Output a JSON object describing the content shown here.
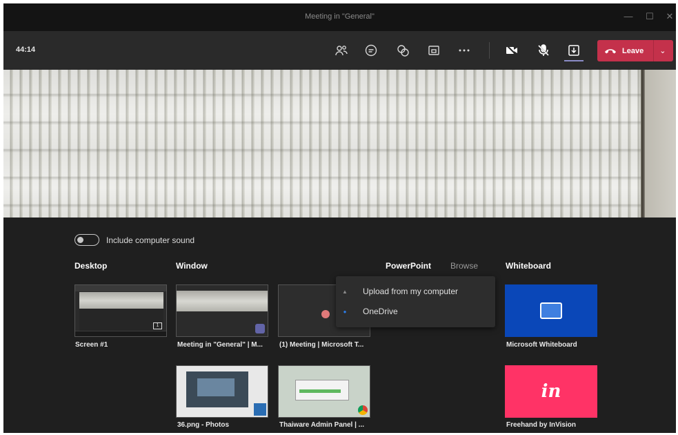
{
  "window": {
    "title": "Meeting in \"General\"",
    "controls": [
      "minimize-icon",
      "maximize-icon",
      "close-icon"
    ]
  },
  "toolbar": {
    "timer": "44:14",
    "icons": [
      "participants-icon",
      "chat-icon",
      "reactions-icon",
      "rooms-icon",
      "more-options-icon",
      "camera-off-icon",
      "mic-off-icon",
      "share-tray-icon"
    ],
    "leave_label": "Leave",
    "leave_color": "#c4314b",
    "accent": "#8b8cc7"
  },
  "tray": {
    "sound_toggle": {
      "label": "Include computer sound",
      "on": false
    },
    "sections": {
      "desktop": "Desktop",
      "window": "Window",
      "powerpoint": "PowerPoint",
      "browse": "Browse",
      "whiteboard": "Whiteboard"
    },
    "desktop_items": [
      {
        "label": "Screen #1",
        "badge": "1"
      }
    ],
    "window_items": [
      {
        "label": "Meeting in \"General\" | M..."
      },
      {
        "label": "(1) Meeting | Microsoft T..."
      },
      {
        "label": "36.png - Photos"
      },
      {
        "label": "Thaiware Admin Panel | ..."
      }
    ],
    "whiteboard_items": [
      {
        "label": "Microsoft Whiteboard",
        "color": "#0a47b8"
      },
      {
        "label": "Freehand by InVision",
        "color": "#ff3366",
        "logo_text": "in"
      }
    ]
  },
  "browse_menu": {
    "items": [
      {
        "label": "Upload from my computer",
        "icon": "upload-icon"
      },
      {
        "label": "OneDrive",
        "icon": "onedrive-icon"
      }
    ]
  }
}
